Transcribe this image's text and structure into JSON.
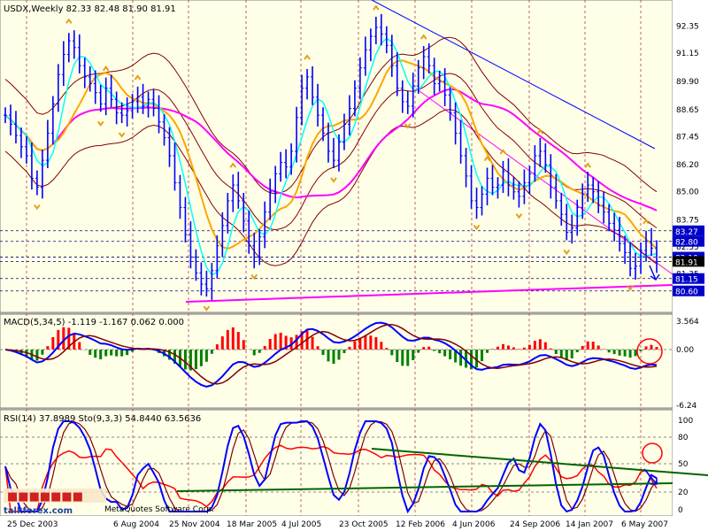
{
  "main": {
    "header": "USDX,Weekly  82.33 82.48 81.90 81.91",
    "price_ticks": [
      "92.35",
      "91.15",
      "89.90",
      "88.65",
      "87.45",
      "86.20",
      "85.00",
      "83.75",
      "82.55",
      "81.35"
    ],
    "price_levels": [
      {
        "value": 83.27,
        "label": "83.27",
        "bg": "#0000c8"
      },
      {
        "value": 82.8,
        "label": "82.80",
        "bg": "#0000c8"
      },
      {
        "value": 82.1,
        "label": "82.10",
        "bg": "#0000c8"
      },
      {
        "value": 81.91,
        "label": "81.91",
        "bg": "#000000"
      },
      {
        "value": 81.15,
        "label": "81.15",
        "bg": "#0000c8"
      },
      {
        "value": 80.6,
        "label": "80.60",
        "bg": "#0000c8"
      }
    ],
    "ylim": [
      80.0,
      93.2
    ]
  },
  "macd": {
    "header": "MACD(5,34,5) -1.119 -1.167 0.062 0.000",
    "ticks": [
      "3.564",
      "0.00",
      "-6.24"
    ]
  },
  "osc": {
    "header": "RSI(14) 37.8989  Sto(9,3,3) 54.8440 63.5636",
    "ticks": [
      "100",
      "80",
      "50",
      "20",
      "0"
    ]
  },
  "x_labels": [
    "25 Dec 2003",
    "6 Aug 2004",
    "25 Nov 2004",
    "18 Mar 2005",
    "4 Jul 2005",
    "23 Oct 2005",
    "12 Feb 2006",
    "4 Jun 2006",
    "24 Sep 2006",
    "14 Jan 2007",
    "6 May 2007"
  ],
  "watermark": {
    "copyright": "MetaQuotes Software Corp.",
    "site": "talkforex.com"
  },
  "colors": {
    "background": "#ffffe8",
    "price_bars": "#0000ff",
    "macd_line": "#0000ff",
    "signal_line": "#800000",
    "hist_up": "#ff0000",
    "hist_down": "#008000",
    "rsi_line": "#ff0000",
    "stoch_main": "#0000ff",
    "stoch_signal": "#800000",
    "ma_orange": "#ffa500",
    "ma_magenta": "#ff00ff",
    "ma_cyan": "#00ffff"
  },
  "chart_data": {
    "type": "line",
    "title": "USDX,Weekly",
    "ohlc_last": {
      "open": 82.33,
      "high": 82.48,
      "low": 81.9,
      "close": 81.91
    },
    "close_series": [
      88.4,
      88.0,
      87.5,
      87.0,
      86.6,
      85.6,
      85.2,
      86.4,
      87.6,
      88.9,
      90.2,
      91.1,
      91.7,
      91.4,
      90.6,
      90.1,
      89.8,
      89.4,
      88.9,
      89.6,
      89.1,
      88.5,
      88.4,
      88.6,
      89.0,
      89.2,
      88.8,
      89.1,
      88.7,
      88.1,
      87.4,
      86.6,
      85.4,
      84.3,
      83.1,
      82.1,
      81.4,
      80.9,
      80.7,
      81.5,
      82.6,
      83.5,
      84.6,
      85.3,
      84.6,
      83.7,
      82.6,
      82.1,
      83.0,
      84.1,
      85.0,
      85.8,
      86.3,
      86.1,
      86.8,
      88.3,
      89.6,
      90.1,
      89.2,
      88.4,
      87.6,
      86.8,
      86.4,
      87.2,
      88.0,
      88.7,
      89.6,
      90.5,
      91.3,
      91.9,
      92.3,
      92.0,
      91.5,
      90.6,
      89.6,
      89.0,
      88.8,
      89.7,
      90.5,
      91.0,
      90.6,
      89.8,
      89.9,
      89.3,
      88.5,
      87.6,
      86.6,
      85.7,
      84.6,
      84.3,
      84.9,
      85.6,
      85.2,
      85.3,
      85.9,
      85.3,
      85.0,
      84.8,
      85.4,
      85.8,
      86.6,
      86.8,
      86.2,
      85.2,
      84.6,
      84.0,
      83.2,
      83.4,
      84.3,
      84.9,
      85.3,
      85.0,
      84.4,
      84.1,
      83.6,
      83.3,
      82.7,
      82.3,
      81.6,
      81.7,
      82.4,
      82.8,
      82.5,
      81.9
    ],
    "ylim": [
      80.0,
      93.2
    ],
    "levels": [
      83.27,
      82.8,
      82.1,
      81.91,
      81.15,
      80.6
    ]
  }
}
